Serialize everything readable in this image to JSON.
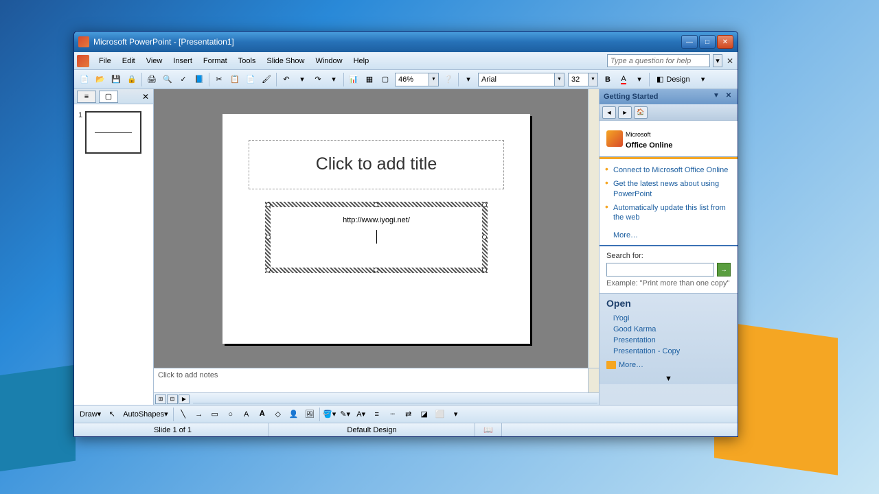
{
  "titlebar": {
    "title": "Microsoft PowerPoint - [Presentation1]"
  },
  "menu": {
    "file": "File",
    "edit": "Edit",
    "view": "View",
    "insert": "Insert",
    "format": "Format",
    "tools": "Tools",
    "slideshow": "Slide Show",
    "window": "Window",
    "help": "Help"
  },
  "help_box": {
    "placeholder": "Type a question for help"
  },
  "toolbar": {
    "zoom": "46%",
    "font": "Arial",
    "size": "32",
    "design": "Design"
  },
  "accent_color": "#f5a623",
  "slide": {
    "number": "1",
    "title_placeholder": "Click to add title",
    "subtitle_text": "http://www.iyogi.net/"
  },
  "notes": {
    "placeholder": "Click to add notes"
  },
  "taskpane": {
    "title": "Getting Started",
    "office_online": "Office Online",
    "office_prefix": "Microsoft",
    "links": [
      "Connect to Microsoft Office Online",
      "Get the latest news about using PowerPoint",
      "Automatically update this list from the web"
    ],
    "more": "More…",
    "search_label": "Search for:",
    "example_label": "Example:",
    "example_text": "\"Print more than one copy\"",
    "open_header": "Open",
    "open_items": [
      "iYogi",
      "Good Karma",
      "Presentation",
      "Presentation - Copy"
    ],
    "open_more": "More…"
  },
  "drawbar": {
    "draw": "Draw",
    "autoshapes": "AutoShapes"
  },
  "statusbar": {
    "slide": "Slide 1 of 1",
    "design": "Default Design"
  }
}
